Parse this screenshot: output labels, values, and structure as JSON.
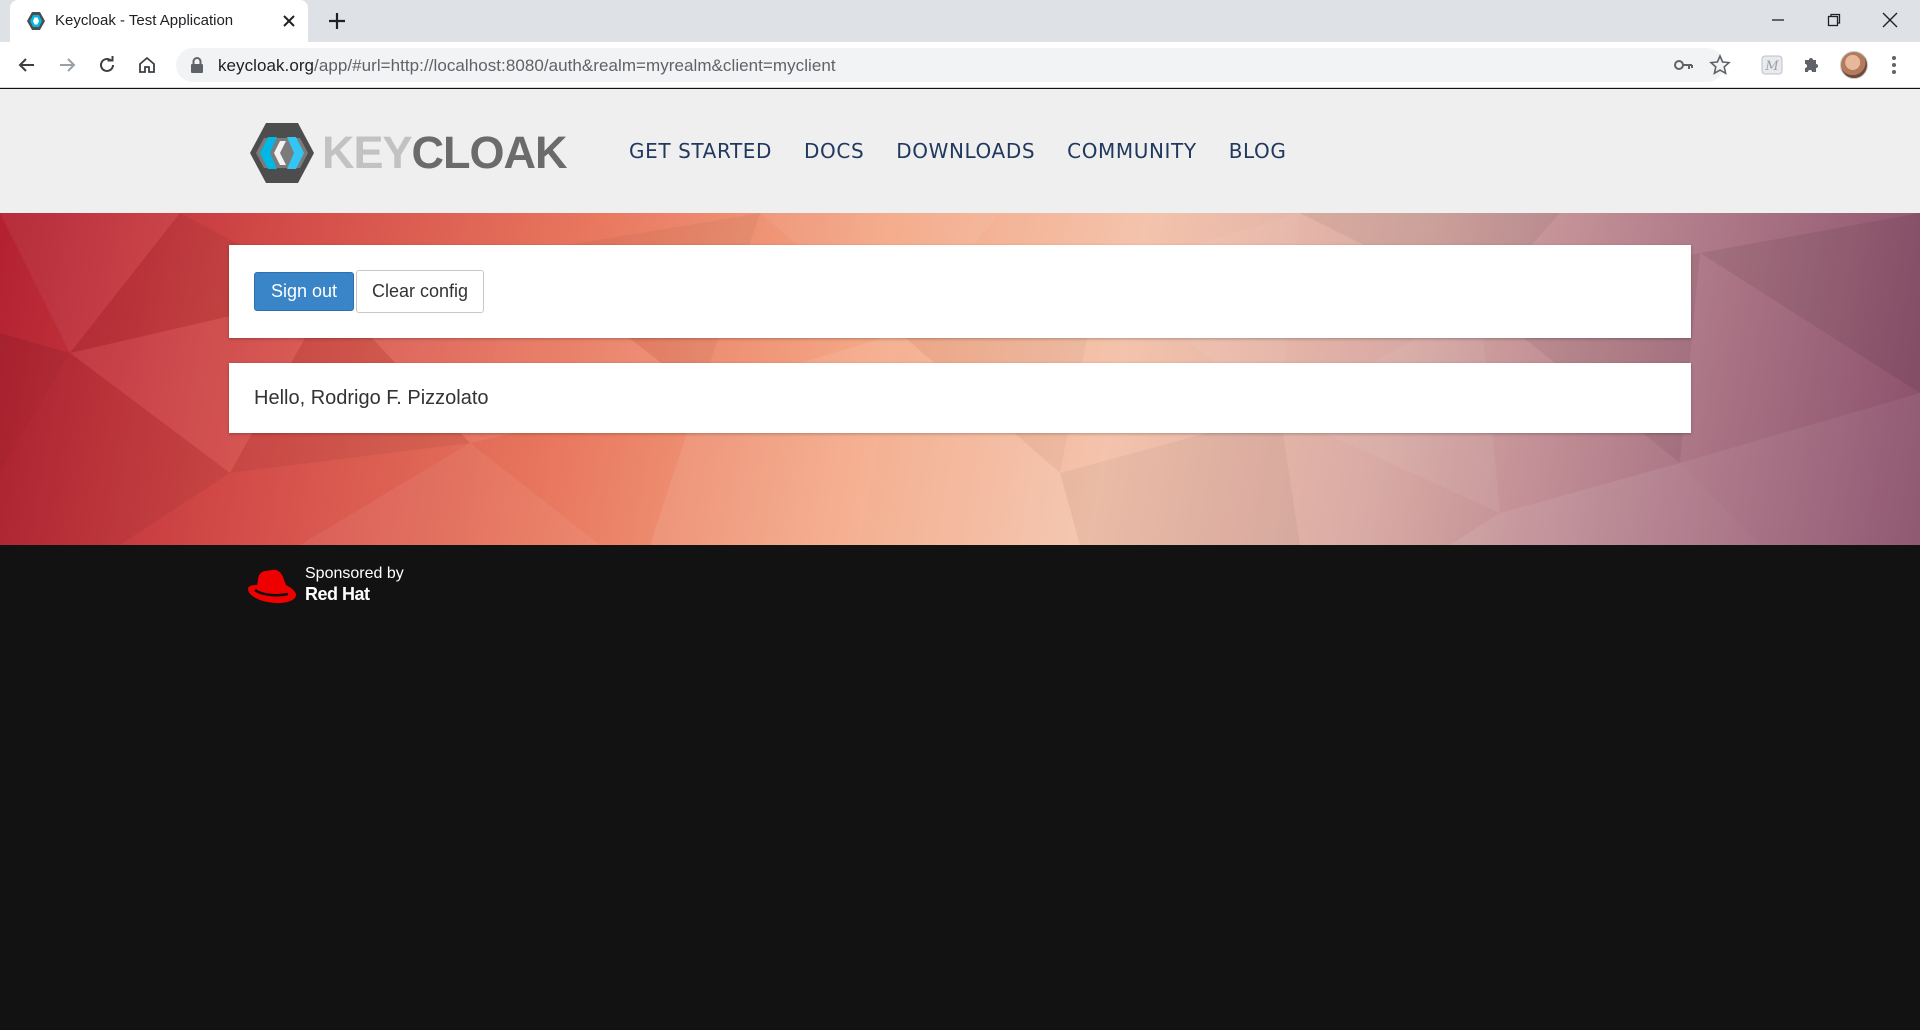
{
  "browser": {
    "tab_title": "Keycloak - Test Application",
    "url_host": "keycloak.org",
    "url_rest": "/app/#url=http://localhost:8080/auth&realm=myrealm&client=myclient"
  },
  "site": {
    "logo_text_light": "KEY",
    "logo_text_dark": "CLOAK",
    "nav": [
      "GET STARTED",
      "DOCS",
      "DOWNLOADS",
      "COMMUNITY",
      "BLOG"
    ]
  },
  "app": {
    "signout_label": "Sign out",
    "clear_label": "Clear config",
    "greeting": "Hello, Rodrigo F. Pizzolato"
  },
  "footer": {
    "sponsored_by": "Sponsored by",
    "sponsor_name": "Red Hat"
  },
  "colors": {
    "primary_button": "#3a84c8",
    "nav_text": "#21395e",
    "redhat_red": "#ee0000",
    "footer_bg": "#121212"
  }
}
